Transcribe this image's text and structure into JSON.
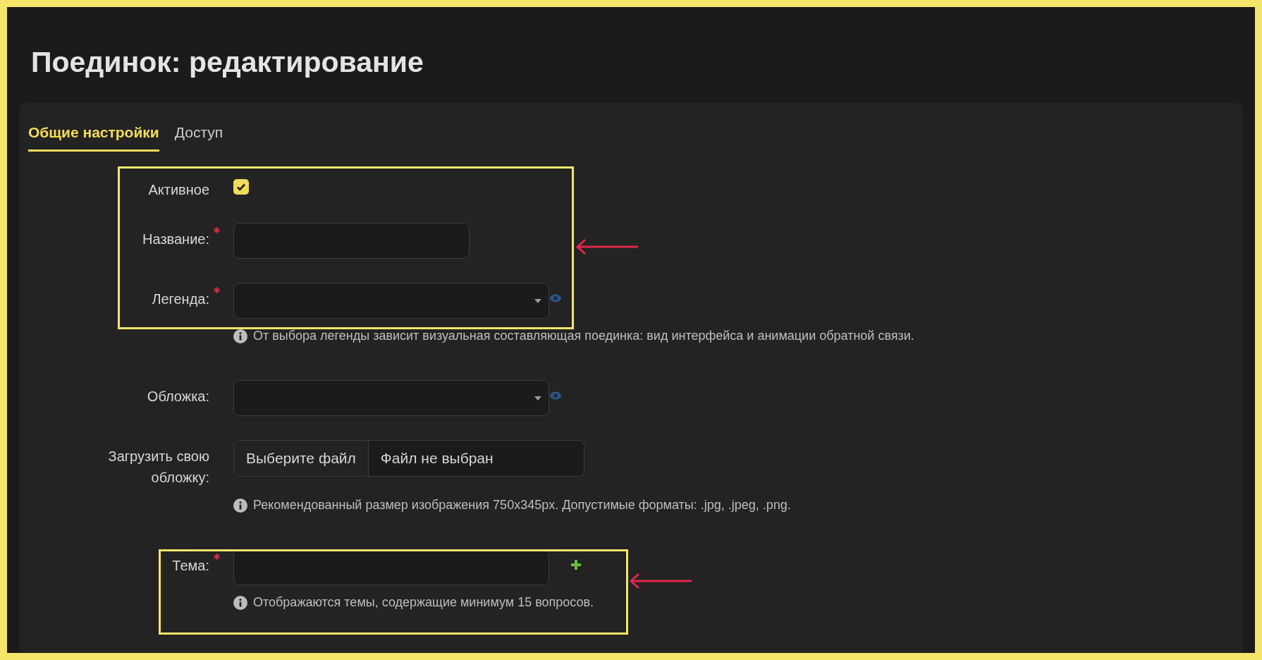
{
  "title": "Поединок: редактирование",
  "tabs": [
    {
      "label": "Общие настройки",
      "selected": true
    },
    {
      "label": "Доступ",
      "selected": false
    }
  ],
  "fields": [
    {
      "kind": "checkbox",
      "label": "Активное",
      "checked": true
    },
    {
      "kind": "text",
      "label": "Название:",
      "required": true
    },
    {
      "kind": "select",
      "label": "Легенда:",
      "required": true,
      "preview": true,
      "hint": "От выбора легенды зависит визуальная составляющая поединка: вид интерфейса и анимации обратной связи."
    },
    {
      "kind": "select",
      "label": "Обложка:",
      "preview": true
    },
    {
      "kind": "file",
      "label": "Загрузить свою обложку:",
      "button": "Выберите файл",
      "status": "Файл не выбран",
      "hint": "Рекомендованный размер изображения 750x345px. Допустимые форматы: .jpg, .jpeg, .png."
    },
    {
      "kind": "text",
      "label": "Тема:",
      "required": true,
      "add": true,
      "hint": "Отображаются темы, содержащие минимум 15 вопросов."
    }
  ]
}
